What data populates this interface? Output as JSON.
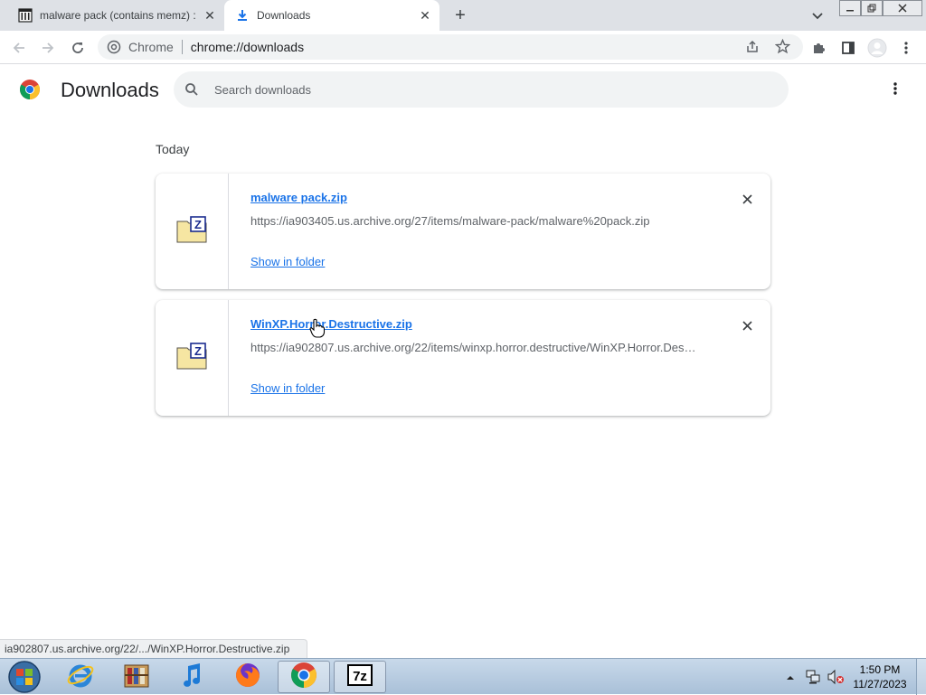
{
  "tabs": [
    {
      "title": "malware pack (contains memz) :",
      "active": false
    },
    {
      "title": "Downloads",
      "active": true
    }
  ],
  "toolbar": {
    "site_label": "Chrome",
    "url": "chrome://downloads"
  },
  "header": {
    "title": "Downloads",
    "search_placeholder": "Search downloads"
  },
  "section_label": "Today",
  "downloads": [
    {
      "file_name": "malware pack.zip",
      "url": "https://ia903405.us.archive.org/27/items/malware-pack/malware%20pack.zip",
      "action": "Show in folder"
    },
    {
      "file_name": "WinXP.Horror.Destructive.zip",
      "url": "https://ia902807.us.archive.org/22/items/winxp.horror.destructive/WinXP.Horror.Des…",
      "action": "Show in folder"
    }
  ],
  "status_bar": "ia902807.us.archive.org/22/.../WinXP.Horror.Destructive.zip",
  "taskbar": {
    "apps": [
      "start-orb",
      "internet-explorer",
      "archive-app",
      "itunes",
      "firefox",
      "chrome",
      "7zip"
    ],
    "clock_time": "1:50 PM",
    "clock_date": "11/27/2023"
  },
  "colors": {
    "link": "#1a73e8",
    "tabstrip": "#dee1e6",
    "taskbar": "#b6cbe0"
  }
}
